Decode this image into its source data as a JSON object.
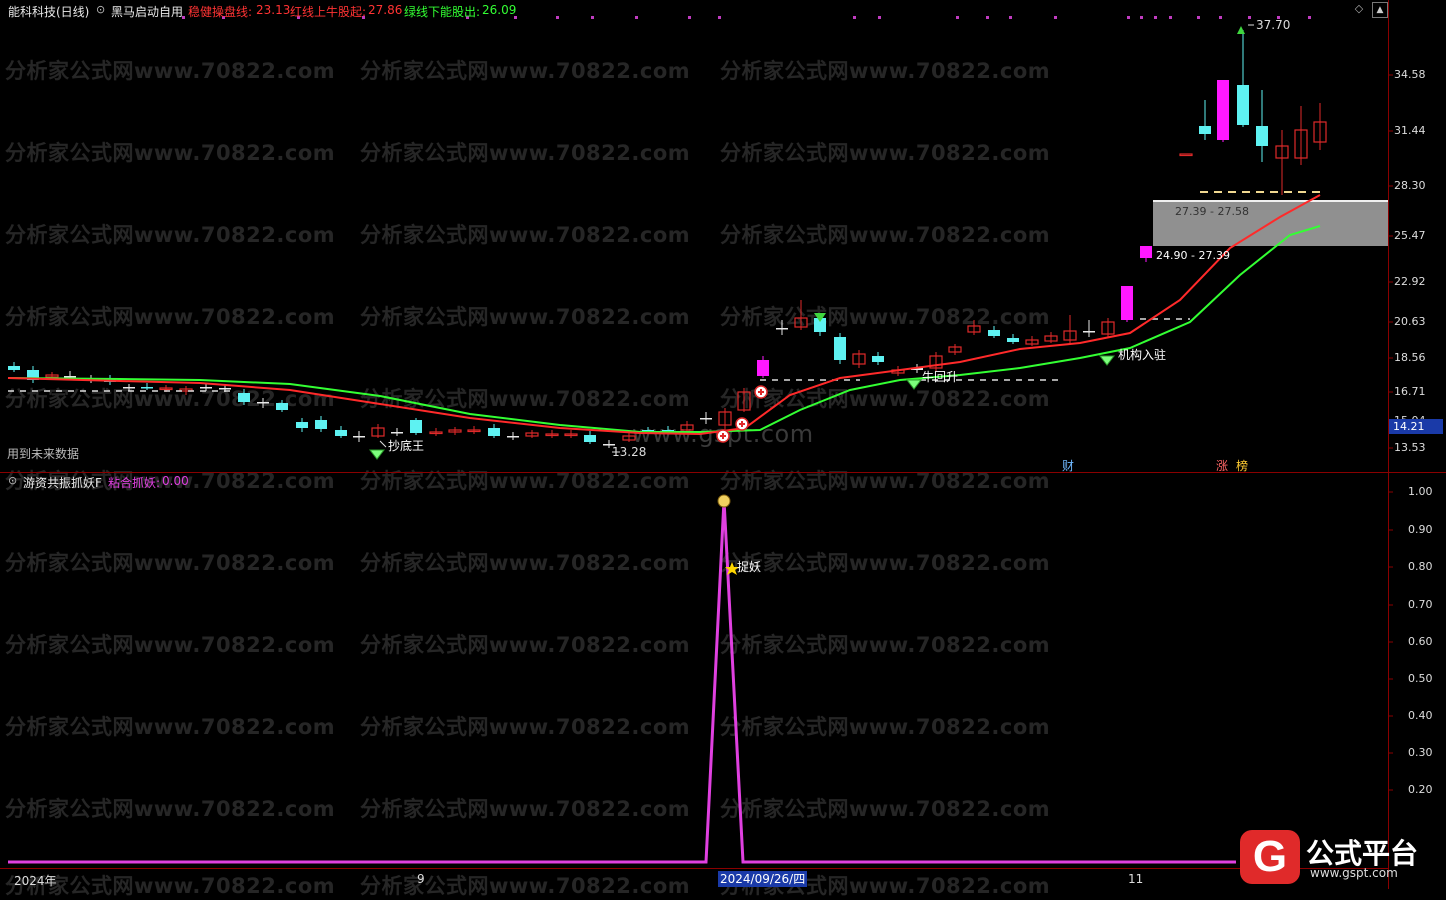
{
  "price_panel": {
    "stock_title": "能科科技(日线)",
    "indicator_name": "黑马启动自用",
    "legend": [
      {
        "label": "稳健操盘线:",
        "value": "23.13",
        "color": "#ff3333"
      },
      {
        "label": "红线上牛股起:",
        "value": "27.86",
        "color": "#ff3333"
      },
      {
        "label": "绿线下能股出:",
        "value": "26.09",
        "color": "#33ff33"
      }
    ],
    "y_ticks": [
      "34.58",
      "31.44",
      "28.30",
      "25.47",
      "22.92",
      "20.63",
      "18.56",
      "16.71",
      "15.04",
      "13.53"
    ],
    "current_price_tag": "14.21",
    "future_data_note": "用到未来数据",
    "annotations": {
      "high_label": "37.70",
      "low_label": "13.28",
      "chaodi": "抄底王",
      "niuhuisheng": "牛回升",
      "jigou": "机构入驻",
      "range_upper": "27.39 - 27.58",
      "range_lower": "24.90 - 27.39",
      "cai": "财",
      "zhang": "涨",
      "bang": "榜"
    },
    "legend_lines": {
      "red": "#ff2a2a",
      "green": "#33ff33"
    }
  },
  "indicator_panel": {
    "name": "游资共振抓妖F",
    "legend_label": "粘合抓妖:",
    "legend_value": "0.00",
    "y_ticks": [
      "1.00",
      "0.90",
      "0.80",
      "0.70",
      "0.60",
      "0.50",
      "0.40",
      "0.30",
      "0.20"
    ],
    "spike_label": "捉妖",
    "line_color": "#e040e0"
  },
  "x_axis": {
    "labels": [
      "2024年",
      "9",
      "11"
    ],
    "cursor_date": "2024/09/26/四"
  },
  "watermarks": {
    "site_text": "分析家公式网www.70822.com",
    "center_site": "www.gspt.com"
  },
  "logo": {
    "text": "公式平台",
    "url_text": "www.gspt.com",
    "glyph": "G"
  },
  "icons": [
    "dropdown-circle-icon",
    "diamond-icon",
    "scroll-up-icon",
    "scroll-down-icon",
    "moneybag-icon",
    "star-icon",
    "plus-circle-icon",
    "green-arrow-down-icon"
  ]
}
